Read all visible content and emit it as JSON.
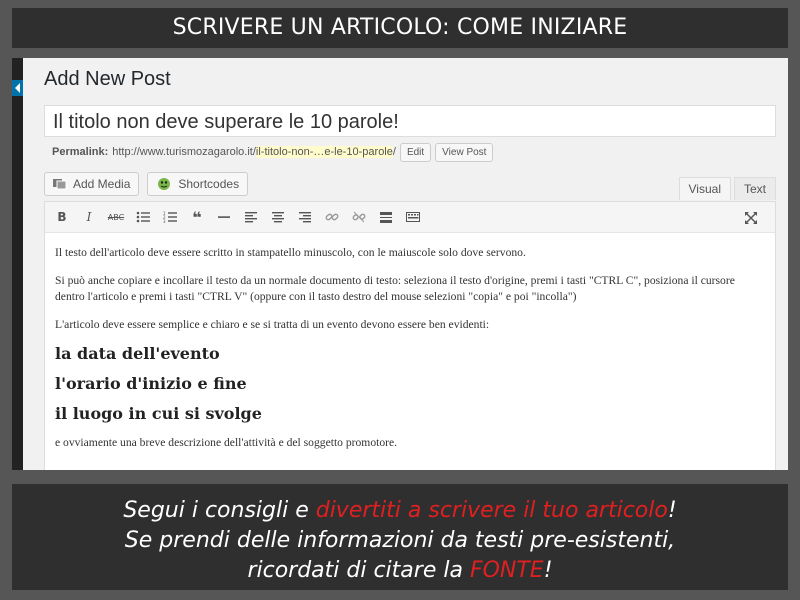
{
  "banner": {
    "title": "SCRIVERE UN ARTICOLO: COME INIZIARE"
  },
  "editor": {
    "page_title": "Add New Post",
    "post_title": "Il titolo non deve superare le 10 parole!",
    "permalink_label": "Permalink:",
    "permalink_base": "http://www.turismozagarolo.it/",
    "permalink_slug": "il-titolo-non-…e-le-10-parole",
    "permalink_tail": "/",
    "edit_button": "Edit",
    "view_post_button": "View Post",
    "add_media": "Add Media",
    "shortcodes": "Shortcodes",
    "tab_visual": "Visual",
    "tab_text": "Text",
    "toolbar_icons": [
      "bold-icon",
      "italic-icon",
      "strikethrough-icon",
      "bullet-list-icon",
      "numbered-list-icon",
      "blockquote-icon",
      "horizontal-rule-icon",
      "align-left-icon",
      "align-center-icon",
      "align-right-icon",
      "link-icon",
      "unlink-icon",
      "read-more-icon",
      "toolbar-toggle-icon",
      "fullscreen-icon"
    ],
    "body": {
      "p1": "Il testo dell'articolo deve essere scritto in stampatello minuscolo, con le maiuscole solo dove servono.",
      "p2": "Si può anche copiare e incollare il testo da un normale documento di testo: seleziona il testo d'origine, premi i tasti \"CTRL C\", posiziona il cursore dentro l'articolo e premi i tasti \"CTRL V\" (oppure con il tasto destro del mouse selezioni \"copia\" e poi \"incolla\")",
      "p3": "L'articolo deve essere semplice e chiaro e se si tratta di un evento devono essere ben evidenti:",
      "h1": "la data dell'evento",
      "h2": "l'orario d'inizio e fine",
      "h3": "il luogo in cui si svolge",
      "p4": "e ovviamente una breve descrizione dell'attività e del soggetto promotore."
    }
  },
  "footer": {
    "line1_a": "Segui i consigli e ",
    "line1_red": "divertiti a scrivere il tuo articolo",
    "line1_b": "!",
    "line2": "Se prendi delle informazioni da testi pre-esistenti,",
    "line3_a": "ricordati di citare la ",
    "line3_red": "FONTE",
    "line3_b": "!"
  },
  "colors": {
    "accent_red": "#e02020",
    "wp_blue": "#0073aa",
    "banner_bg": "#2f2f2f"
  }
}
